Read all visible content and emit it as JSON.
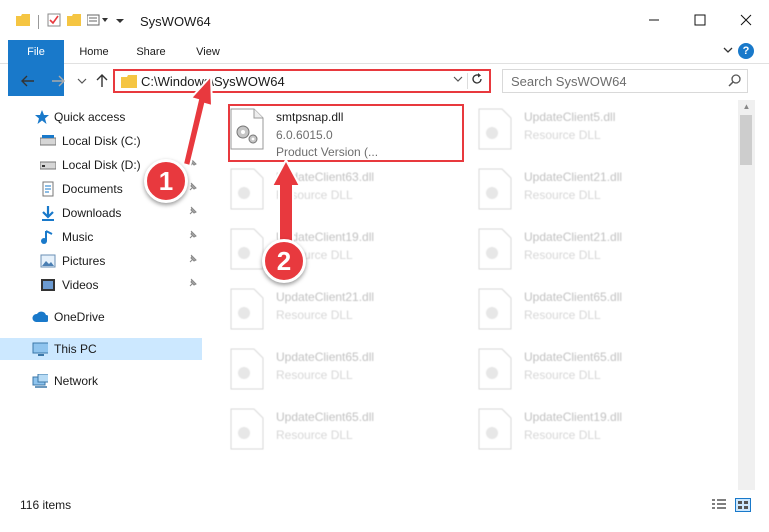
{
  "window": {
    "title": "SysWOW64",
    "controls": {
      "minimize": "—",
      "maximize": "☐",
      "close": "✕"
    }
  },
  "ribbon": {
    "tabs": [
      {
        "label": "File"
      },
      {
        "label": "Home"
      },
      {
        "label": "Share"
      },
      {
        "label": "View"
      }
    ],
    "help": "?"
  },
  "address": {
    "path": "C:\\Windows\\SysWOW64",
    "search_placeholder": "Search SysWOW64"
  },
  "nav_pane": {
    "quick_access": "Quick access",
    "items": [
      {
        "label": "Local Disk (C:)",
        "icon": "drive-icon",
        "pinned": true
      },
      {
        "label": "Local Disk (D:)",
        "icon": "drive-icon",
        "pinned": true
      },
      {
        "label": "Documents",
        "icon": "documents-icon",
        "pinned": true
      },
      {
        "label": "Downloads",
        "icon": "download-icon",
        "pinned": true
      },
      {
        "label": "Music",
        "icon": "music-icon",
        "pinned": true
      },
      {
        "label": "Pictures",
        "icon": "pictures-icon",
        "pinned": true
      },
      {
        "label": "Videos",
        "icon": "videos-icon",
        "pinned": true
      }
    ],
    "onedrive": "OneDrive",
    "this_pc": "This PC",
    "network": "Network"
  },
  "files": {
    "highlighted": {
      "name": "smtpsnap.dll",
      "version": "6.0.6015.0",
      "product": "Product Version    (..."
    },
    "others": [
      {
        "name": "UpdateClient5.dll",
        "type": "Resource DLL"
      },
      {
        "name": "UpdateClient63.dll",
        "type": "Resource DLL"
      },
      {
        "name": "UpdateClient21.dll",
        "type": "Resource DLL"
      },
      {
        "name": "UpdateClient19.dll",
        "type": "Resource DLL"
      },
      {
        "name": "UpdateClient21.dll",
        "type": "Resource DLL"
      },
      {
        "name": "UpdateClient21.dll",
        "type": "Resource DLL"
      },
      {
        "name": "UpdateClient65.dll",
        "type": "Resource DLL"
      },
      {
        "name": "UpdateClient65.dll",
        "type": "Resource DLL"
      },
      {
        "name": "UpdateClient65.dll",
        "type": "Resource DLL"
      },
      {
        "name": "UpdateClient65.dll",
        "type": "Resource DLL"
      },
      {
        "name": "UpdateClient19.dll",
        "type": "Resource DLL"
      }
    ]
  },
  "status": {
    "item_count": "116 items"
  },
  "annotations": {
    "step1": "1",
    "step2": "2",
    "color": "#e8393e"
  },
  "colors": {
    "accent": "#1979ca",
    "highlight": "#e8393e",
    "selected_bg": "#cce8ff"
  }
}
